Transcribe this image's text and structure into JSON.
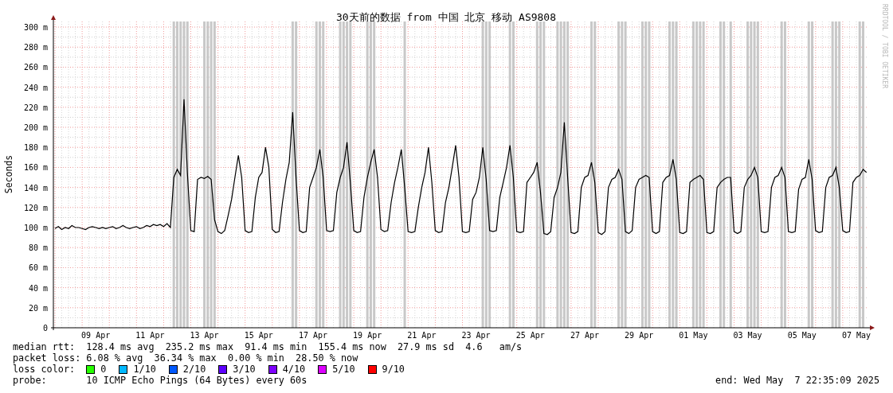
{
  "chart": {
    "title": "30天前的数据 from 中国 北京 移动 AS9808",
    "credit": "RRDTOOL / TOBI OETIKER",
    "chart_data": {
      "type": "line",
      "ylabel": "Seconds",
      "ylim": [
        0,
        305.6
      ],
      "yticks": [
        {
          "value": 0,
          "label": "0"
        },
        {
          "value": 20,
          "label": "20 m"
        },
        {
          "value": 40,
          "label": "40 m"
        },
        {
          "value": 60,
          "label": "60 m"
        },
        {
          "value": 80,
          "label": "80 m"
        },
        {
          "value": 100,
          "label": "100 m"
        },
        {
          "value": 120,
          "label": "120 m"
        },
        {
          "value": 140,
          "label": "140 m"
        },
        {
          "value": 160,
          "label": "160 m"
        },
        {
          "value": 180,
          "label": "180 m"
        },
        {
          "value": 200,
          "label": "200 m"
        },
        {
          "value": 220,
          "label": "220 m"
        },
        {
          "value": 240,
          "label": "240 m"
        },
        {
          "value": 260,
          "label": "260 m"
        },
        {
          "value": 280,
          "label": "280 m"
        },
        {
          "value": 300,
          "label": "300 m"
        }
      ],
      "categories": [
        null,
        null,
        null,
        null,
        null,
        null,
        null,
        null,
        null,
        null,
        null,
        null,
        "09 Apr",
        null,
        null,
        null,
        null,
        null,
        null,
        null,
        null,
        null,
        null,
        null,
        null,
        null,
        null,
        null,
        "11 Apr",
        null,
        null,
        null,
        null,
        null,
        null,
        null,
        null,
        null,
        null,
        null,
        null,
        null,
        null,
        null,
        "13 Apr",
        null,
        null,
        null,
        null,
        null,
        null,
        null,
        null,
        null,
        null,
        null,
        null,
        null,
        null,
        null,
        "15 Apr",
        null,
        null,
        null,
        null,
        null,
        null,
        null,
        null,
        null,
        null,
        null,
        null,
        null,
        null,
        null,
        "17 Apr",
        null,
        null,
        null,
        null,
        null,
        null,
        null,
        null,
        null,
        null,
        null,
        null,
        null,
        null,
        null,
        "19 Apr",
        null,
        null,
        null,
        null,
        null,
        null,
        null,
        null,
        null,
        null,
        null,
        null,
        null,
        null,
        null,
        "21 Apr",
        null,
        null,
        null,
        null,
        null,
        null,
        null,
        null,
        null,
        null,
        null,
        null,
        null,
        null,
        null,
        "23 Apr",
        null,
        null,
        null,
        null,
        null,
        null,
        null,
        null,
        null,
        null,
        null,
        null,
        null,
        null,
        null,
        "25 Apr",
        null,
        null,
        null,
        null,
        null,
        null,
        null,
        null,
        null,
        null,
        null,
        null,
        null,
        null,
        null,
        "27 Apr",
        null,
        null,
        null,
        null,
        null,
        null,
        null,
        null,
        null,
        null,
        null,
        null,
        null,
        null,
        null,
        "29 Apr",
        null,
        null,
        null,
        null,
        null,
        null,
        null,
        null,
        null,
        null,
        null,
        null,
        null,
        null,
        null,
        "01 May",
        null,
        null,
        null,
        null,
        null,
        null,
        null,
        null,
        null,
        null,
        null,
        null,
        null,
        null,
        null,
        "03 May",
        null,
        null,
        null,
        null,
        null,
        null,
        null,
        null,
        null,
        null,
        null,
        null,
        null,
        null,
        null,
        "05 May",
        null,
        null,
        null,
        null,
        null,
        null,
        null,
        null,
        null,
        null,
        null,
        null,
        null,
        null,
        null,
        "07 May",
        null,
        null,
        null
      ],
      "series": [
        {
          "color": "#000000",
          "values": [
            99,
            101,
            98,
            100,
            99,
            102,
            100,
            100,
            99,
            98,
            100,
            101,
            100,
            99,
            100,
            99,
            100,
            101,
            99,
            100,
            102,
            100,
            99,
            100,
            101,
            99,
            100,
            102,
            101,
            103,
            102,
            103,
            101,
            104,
            100,
            150,
            158,
            152,
            228,
            155,
            97,
            96,
            148,
            150,
            149,
            151,
            148,
            108,
            96,
            94,
            97,
            112,
            128,
            150,
            172,
            150,
            97,
            95,
            96,
            130,
            150,
            155,
            180,
            160,
            98,
            95,
            96,
            125,
            148,
            165,
            215,
            150,
            97,
            95,
            96,
            140,
            150,
            160,
            178,
            150,
            97,
            96,
            97,
            135,
            150,
            160,
            185,
            145,
            97,
            95,
            96,
            130,
            150,
            165,
            178,
            150,
            98,
            96,
            97,
            125,
            145,
            160,
            178,
            140,
            96,
            95,
            96,
            120,
            140,
            155,
            180,
            145,
            97,
            95,
            96,
            125,
            140,
            160,
            182,
            150,
            96,
            95,
            96,
            128,
            135,
            150,
            180,
            148,
            97,
            96,
            97,
            130,
            145,
            160,
            182,
            150,
            96,
            95,
            96,
            145,
            150,
            155,
            165,
            135,
            94,
            93,
            96,
            130,
            140,
            155,
            205,
            150,
            95,
            94,
            96,
            140,
            150,
            152,
            165,
            145,
            95,
            93,
            96,
            140,
            148,
            150,
            158,
            148,
            96,
            94,
            97,
            140,
            148,
            150,
            152,
            150,
            96,
            94,
            96,
            145,
            150,
            152,
            168,
            148,
            95,
            94,
            96,
            145,
            148,
            150,
            152,
            148,
            95,
            94,
            96,
            140,
            145,
            148,
            150,
            150,
            96,
            94,
            96,
            140,
            148,
            152,
            160,
            150,
            96,
            95,
            96,
            140,
            150,
            152,
            160,
            150,
            96,
            95,
            96,
            138,
            148,
            150,
            168,
            148,
            97,
            95,
            96,
            140,
            150,
            152,
            160,
            140,
            97,
            95,
            96,
            145,
            150,
            152,
            158,
            155
          ]
        }
      ],
      "grid": true
    },
    "packet_loss": [
      false,
      false,
      false,
      false,
      false,
      false,
      false,
      false,
      false,
      false,
      false,
      false,
      false,
      false,
      false,
      false,
      false,
      false,
      false,
      false,
      false,
      false,
      false,
      false,
      false,
      false,
      false,
      false,
      false,
      false,
      false,
      false,
      false,
      false,
      false,
      true,
      true,
      true,
      true,
      true,
      false,
      false,
      false,
      false,
      true,
      true,
      true,
      true,
      false,
      false,
      false,
      false,
      false,
      false,
      false,
      false,
      false,
      false,
      false,
      false,
      false,
      false,
      false,
      false,
      false,
      false,
      false,
      false,
      false,
      false,
      true,
      true,
      false,
      false,
      false,
      false,
      false,
      true,
      true,
      true,
      false,
      false,
      false,
      false,
      true,
      true,
      true,
      true,
      false,
      false,
      false,
      false,
      true,
      true,
      true,
      false,
      false,
      false,
      false,
      false,
      false,
      false,
      false,
      true,
      false,
      false,
      false,
      false,
      false,
      false,
      false,
      false,
      false,
      false,
      false,
      false,
      false,
      false,
      false,
      false,
      false,
      false,
      false,
      false,
      false,
      false,
      true,
      true,
      true,
      false,
      false,
      false,
      false,
      false,
      true,
      true,
      false,
      false,
      false,
      false,
      false,
      false,
      true,
      true,
      true,
      false,
      false,
      false,
      true,
      true,
      true,
      true,
      false,
      false,
      false,
      false,
      false,
      false,
      true,
      true,
      false,
      false,
      false,
      false,
      false,
      false,
      true,
      true,
      true,
      false,
      false,
      false,
      false,
      true,
      true,
      true,
      false,
      false,
      false,
      false,
      false,
      true,
      true,
      true,
      false,
      false,
      false,
      false,
      true,
      true,
      true,
      true,
      false,
      false,
      false,
      false,
      true,
      true,
      false,
      true,
      false,
      false,
      false,
      false,
      true,
      true,
      true,
      true,
      false,
      false,
      false,
      false,
      false,
      false,
      true,
      true,
      false,
      false,
      false,
      false,
      false,
      false,
      true,
      true,
      false,
      false,
      false,
      false,
      false,
      true,
      true,
      true,
      false,
      false,
      false,
      false,
      false,
      true,
      true,
      false
    ]
  },
  "legend": {
    "rows": [
      {
        "kind": "stats",
        "label": "median rtt:",
        "value": "128.4 ms avg  235.2 ms max  91.4 ms min  155.4 ms now  27.9 ms sd  4.6   am/s"
      },
      {
        "kind": "stats",
        "label": "packet loss:",
        "value": "6.08 % avg  36.34 % max  0.00 % min  28.50 % now"
      },
      {
        "kind": "colors",
        "label": "loss color:",
        "items": [
          {
            "label": "0",
            "color": "#26ff00"
          },
          {
            "label": "1/10",
            "color": "#00b8ff"
          },
          {
            "label": "2/10",
            "color": "#0059ff"
          },
          {
            "label": "3/10",
            "color": "#5e00ff"
          },
          {
            "label": "4/10",
            "color": "#7e00ff"
          },
          {
            "label": "5/10",
            "color": "#dd00ff"
          },
          {
            "label": "9/10",
            "color": "#ff0000"
          }
        ]
      },
      {
        "kind": "probe",
        "label": "probe:",
        "value": "10 ICMP Echo Pings (64 Bytes) every 60s",
        "end": "end: Wed May  7 22:35:09 2025"
      }
    ]
  }
}
